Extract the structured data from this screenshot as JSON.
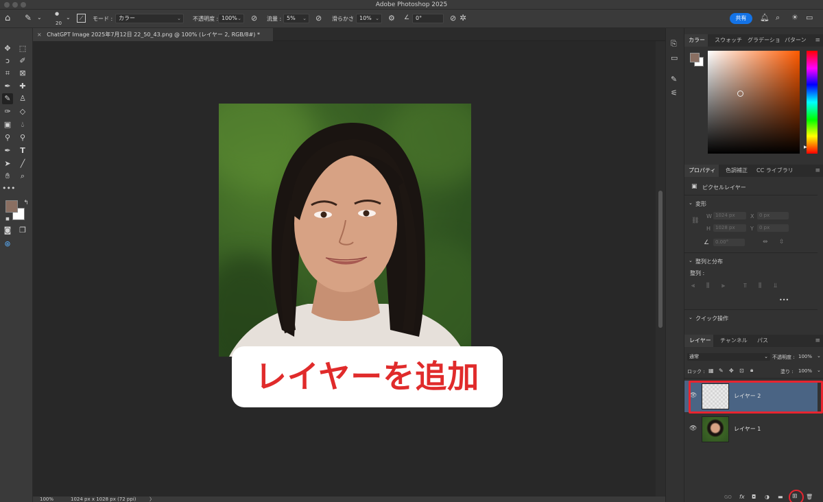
{
  "app": {
    "title": "Adobe Photoshop 2025"
  },
  "options_bar": {
    "brush_size": "20",
    "mode_label": "モード :",
    "mode_value": "カラー",
    "opacity_label": "不透明度 :",
    "opacity_value": "100%",
    "flow_label": "流量 :",
    "flow_value": "5%",
    "smoothing_label": "滑らかさ :",
    "smoothing_value": "10%",
    "angle_value": "0°",
    "share_label": "共有"
  },
  "document": {
    "tab_title": "ChatGPT Image 2025年7月12日 22_50_43.png @ 100% (レイヤー 2, RGB/8#) *",
    "close_glyph": "×"
  },
  "status": {
    "zoom": "100%",
    "dimensions": "1024 px x 1028 px (72 ppi)",
    "arrow": "〉"
  },
  "caption": {
    "text": "レイヤーを追加"
  },
  "panels": {
    "color": {
      "tabs": [
        "カラー",
        "スウォッチ",
        "グラデーショ",
        "パターン"
      ]
    },
    "properties": {
      "tabs": [
        "プロパティ",
        "色調補正",
        "CC ライブラリ"
      ],
      "type_label": "ピクセルレイヤー",
      "transform_heading": "変形",
      "w_label": "W",
      "w_value": "1024 px",
      "x_label": "X",
      "x_value": "0 px",
      "h_label": "H",
      "h_value": "1028 px",
      "y_label": "Y",
      "y_value": "0 px",
      "angle_value": "0.00°",
      "align_heading": "整列と分布",
      "align_sub": "整列 :",
      "more": "•••",
      "quick_heading": "クイック操作"
    },
    "layers": {
      "tabs": [
        "レイヤー",
        "チャンネル",
        "パス"
      ],
      "blend_mode": "通常",
      "opacity_label": "不透明度 :",
      "opacity_value": "100%",
      "lock_label": "ロック :",
      "fill_label": "塗り :",
      "fill_value": "100%",
      "items": [
        {
          "name": "レイヤー 2",
          "selected": true
        },
        {
          "name": "レイヤー 1",
          "selected": false
        }
      ],
      "footer_link": "GO",
      "footer_fx": "fx"
    }
  },
  "colors": {
    "foreground": "#8a6f62",
    "background": "#ffffff",
    "accent": "#1473e6",
    "highlight": "#e8242f",
    "caption_text": "#e02b2b"
  }
}
